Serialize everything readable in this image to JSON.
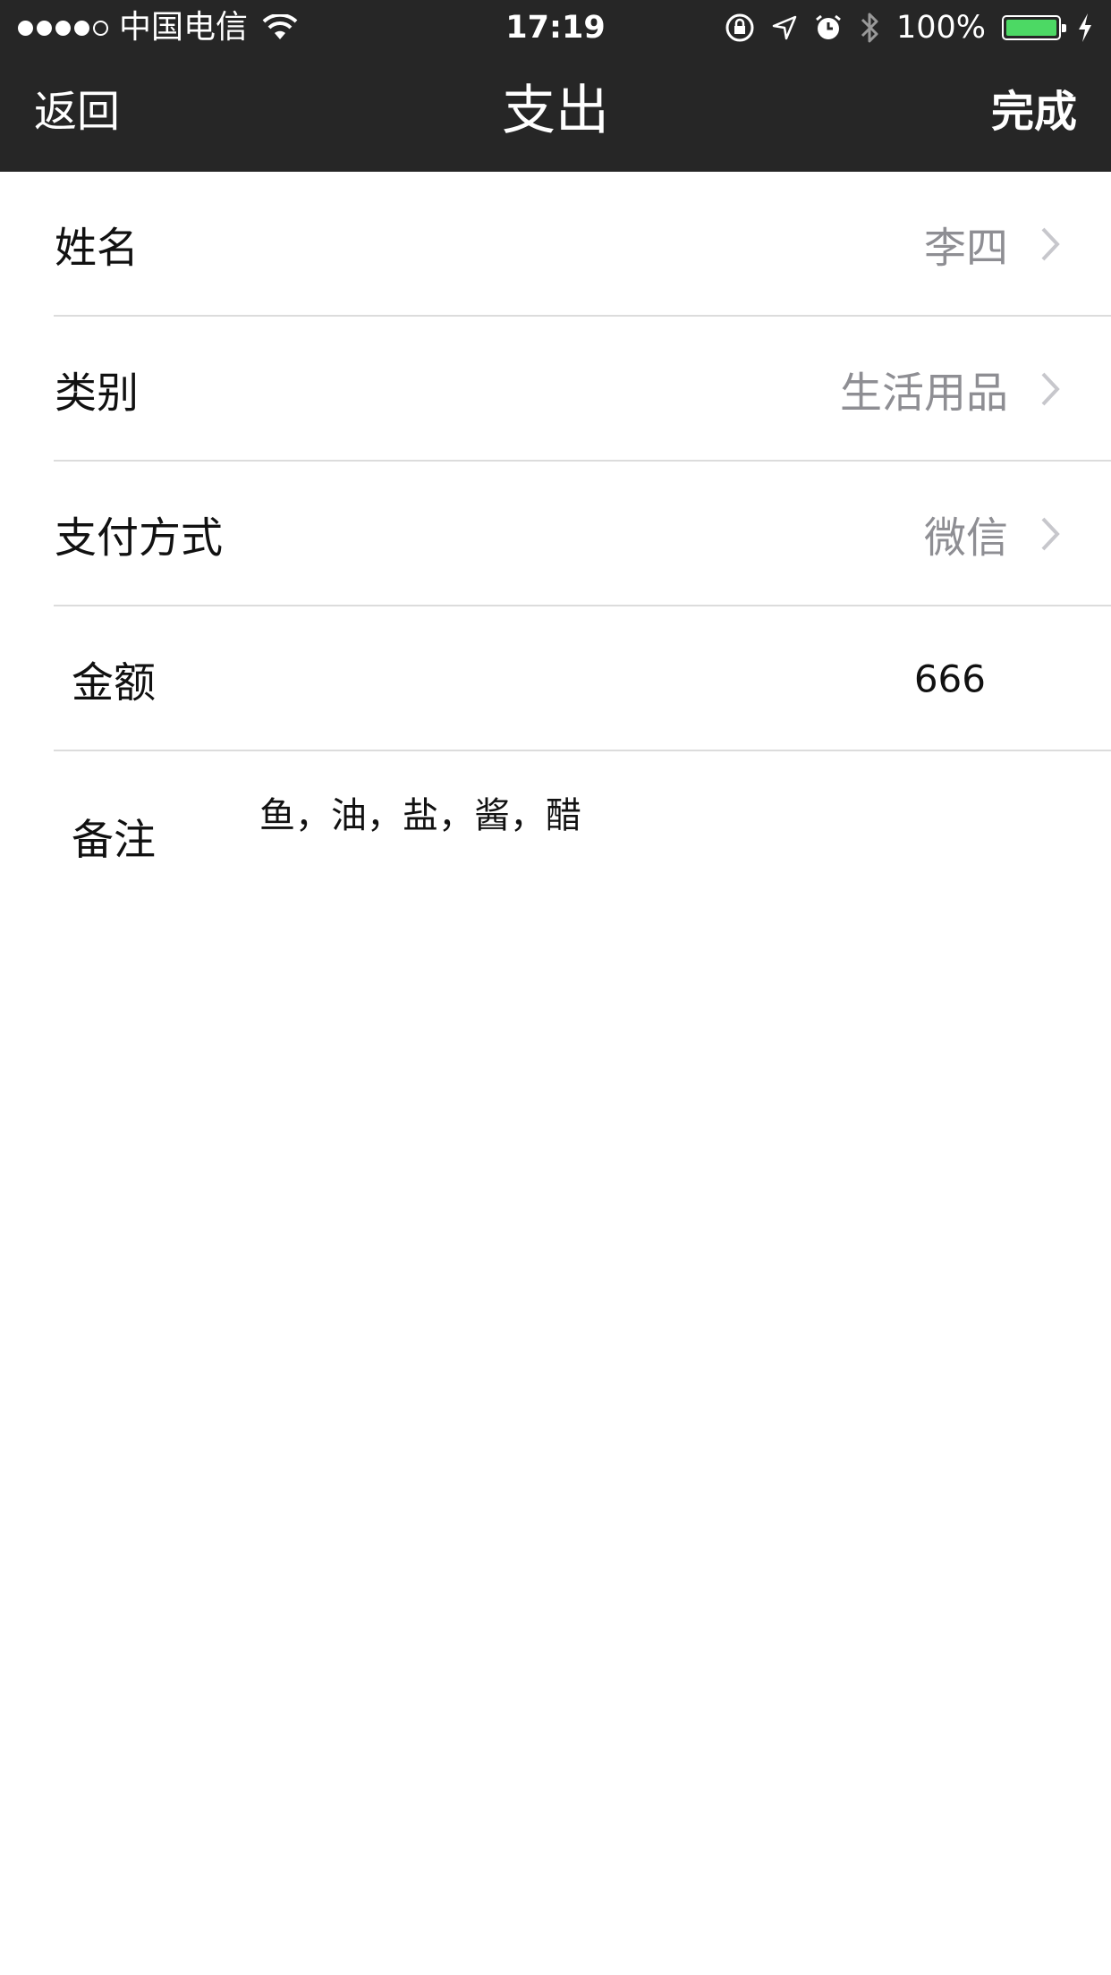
{
  "status_bar": {
    "carrier": "中国电信",
    "time": "17:19",
    "battery_percent": "100%",
    "battery_level": 1.0,
    "battery_color": "#4cd964",
    "icons": [
      "signal-dots-icon",
      "wifi-icon",
      "rotation-lock-icon",
      "location-arrow-icon",
      "alarm-icon",
      "bluetooth-icon",
      "battery-icon",
      "charging-bolt-icon"
    ]
  },
  "nav": {
    "back_label": "返回",
    "title": "支出",
    "done_label": "完成"
  },
  "form": {
    "name": {
      "label": "姓名",
      "value": "李四"
    },
    "category": {
      "label": "类别",
      "value": "生活用品"
    },
    "payment": {
      "label": "支付方式",
      "value": "微信"
    },
    "amount": {
      "label": "金额",
      "value": "666"
    },
    "note": {
      "label": "备注",
      "value": "鱼，油，盐，酱，醋"
    }
  },
  "colors": {
    "nav_background": "#262626",
    "secondary_text": "#8e8e93",
    "separator": "#dcdcdc"
  }
}
